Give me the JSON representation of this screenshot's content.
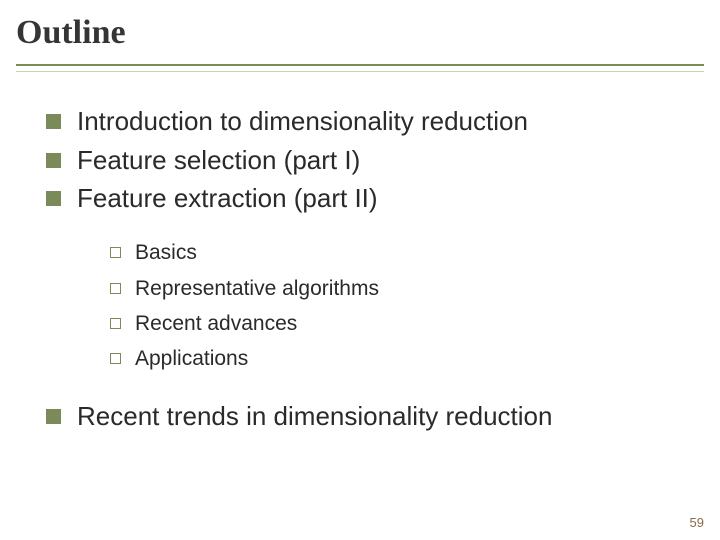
{
  "title": "Outline",
  "items": [
    "Introduction to dimensionality reduction",
    "Feature selection (part I)",
    "Feature extraction (part II)"
  ],
  "subitems": [
    "Basics",
    "Representative algorithms",
    "Recent advances",
    "Applications"
  ],
  "item4": "Recent trends in dimensionality reduction",
  "page": "59"
}
